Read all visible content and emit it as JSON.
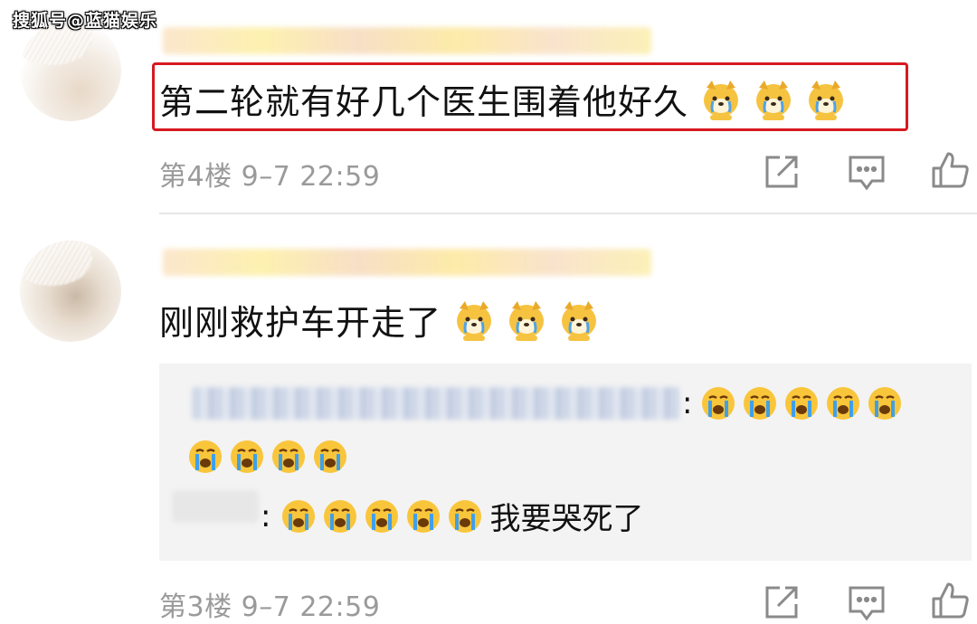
{
  "watermark": "搜狐号@蓝猫娱乐",
  "comments": [
    {
      "text": "第二轮就有好几个医生围着他好久",
      "emojis": [
        "crying-doge-icon",
        "crying-doge-icon",
        "crying-doge-icon"
      ],
      "meta": "第4楼 9–7 22:59",
      "highlighted": true
    },
    {
      "text": "刚刚救护车开走了",
      "emojis": [
        "crying-doge-icon",
        "crying-doge-icon",
        "crying-doge-icon"
      ],
      "meta": "第3楼 9–7 22:59",
      "reply": {
        "line1_prefix": ":",
        "line1_emoji_count": 5,
        "line2_emoji_count": 4,
        "line3_prefix": ":",
        "line3_emoji_count": 5,
        "line3_text": "我要哭死了"
      }
    }
  ],
  "actions": [
    "share-icon",
    "comment-icon",
    "like-icon"
  ],
  "colors": {
    "highlight": "#d71920",
    "meta": "#9a9a9a",
    "reply_bg": "#f3f3f3"
  }
}
